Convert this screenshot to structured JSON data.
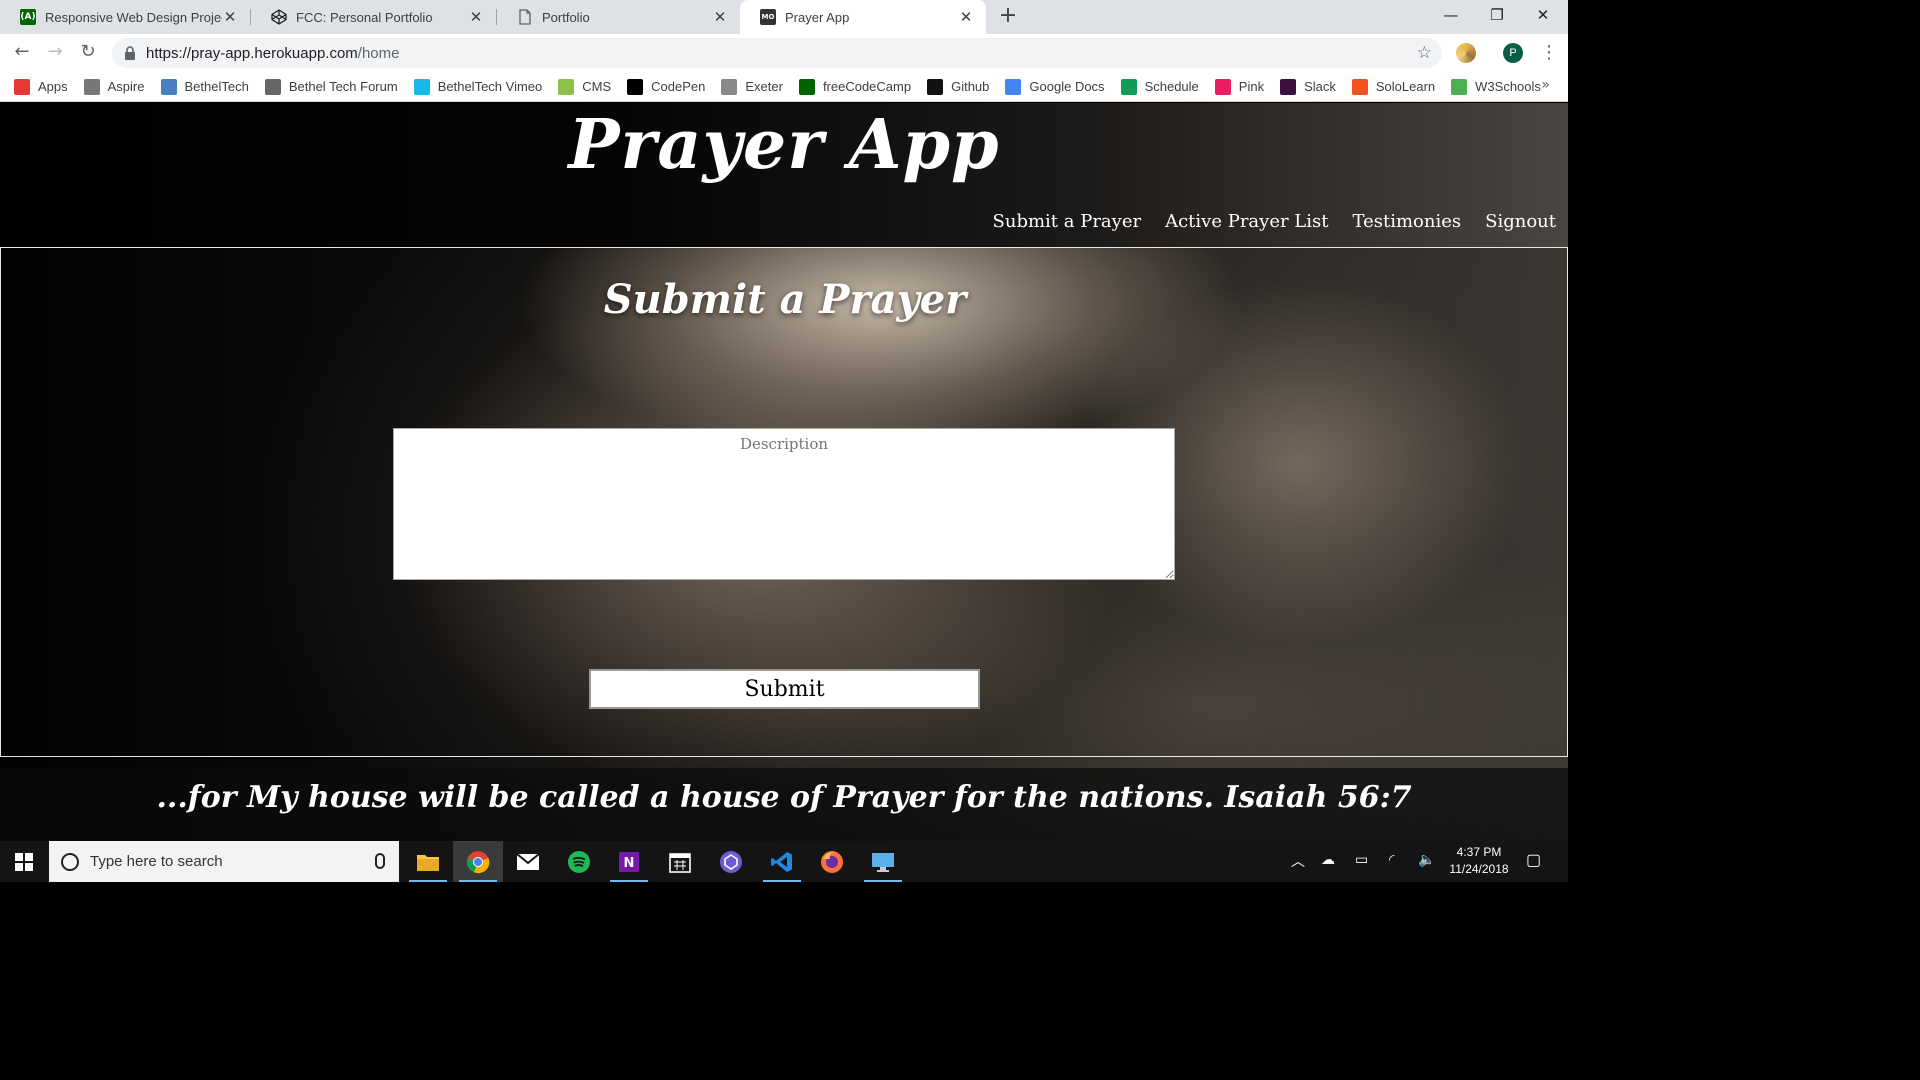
{
  "browser": {
    "tabs": [
      {
        "title": "Responsive Web Design Projects",
        "icon": "freecodecamp-icon",
        "active": false
      },
      {
        "title": "FCC: Personal Portfolio",
        "icon": "codepen-icon",
        "active": false
      },
      {
        "title": "Portfolio",
        "icon": "document-icon",
        "active": false
      },
      {
        "title": "Prayer App",
        "icon": "mo-icon",
        "active": true
      }
    ],
    "new_tab_label": "+",
    "url_host": "https://pray-app.herokuapp.com",
    "url_path": "/home",
    "profile_initial": "P",
    "bookmarks": [
      {
        "label": "Apps",
        "icon": "apps-grid-icon",
        "color": "#e53935"
      },
      {
        "label": "Aspire",
        "icon": "aspire-icon",
        "color": "#777777"
      },
      {
        "label": "BethelTech",
        "icon": "cloud-icon",
        "color": "#4a7fc1"
      },
      {
        "label": "Bethel Tech Forum",
        "icon": "forum-icon",
        "color": "#666666"
      },
      {
        "label": "BethelTech Vimeo",
        "icon": "vimeo-icon",
        "color": "#1ab7ea"
      },
      {
        "label": "CMS",
        "icon": "cms-icon",
        "color": "#8bc34a"
      },
      {
        "label": "CodePen",
        "icon": "codepen-icon",
        "color": "#000000"
      },
      {
        "label": "Exeter",
        "icon": "exeter-icon",
        "color": "#888888"
      },
      {
        "label": "freeCodeCamp",
        "icon": "freecodecamp-icon",
        "color": "#006400"
      },
      {
        "label": "Github",
        "icon": "github-icon",
        "color": "#111111"
      },
      {
        "label": "Google Docs",
        "icon": "google-docs-icon",
        "color": "#4285f4"
      },
      {
        "label": "Schedule",
        "icon": "sheets-icon",
        "color": "#0f9d58"
      },
      {
        "label": "Pink",
        "icon": "pink-icon",
        "color": "#e91e63"
      },
      {
        "label": "Slack",
        "icon": "slack-icon",
        "color": "#3f0e40"
      },
      {
        "label": "SoloLearn",
        "icon": "sololearn-icon",
        "color": "#f4511e"
      },
      {
        "label": "W3Schools",
        "icon": "w3schools-icon",
        "color": "#4caf50"
      }
    ],
    "bookmarks_more": "»"
  },
  "page": {
    "brand": "Prayer App",
    "nav": [
      "Submit a Prayer",
      "Active Prayer List",
      "Testimonies",
      "Signout"
    ],
    "section_title": "Submit a Prayer",
    "description_placeholder": "Description",
    "submit_label": "Submit",
    "verse": "...for My house will be called a house of Prayer for the nations. Isaiah 56:7"
  },
  "taskbar": {
    "search_placeholder": "Type here to search",
    "apps": [
      "file-explorer-icon",
      "chrome-icon",
      "mail-icon",
      "spotify-icon",
      "onenote-icon",
      "calendar-icon",
      "app-icon",
      "vscode-icon",
      "firefox-icon",
      "remote-desktop-icon"
    ],
    "active_app": "chrome-icon",
    "time": "4:37 PM",
    "date": "11/24/2018"
  },
  "colors": {
    "tab_strip": "#dee1e6",
    "taskbar": "#141414",
    "accent_underline": "#76b9ed"
  }
}
